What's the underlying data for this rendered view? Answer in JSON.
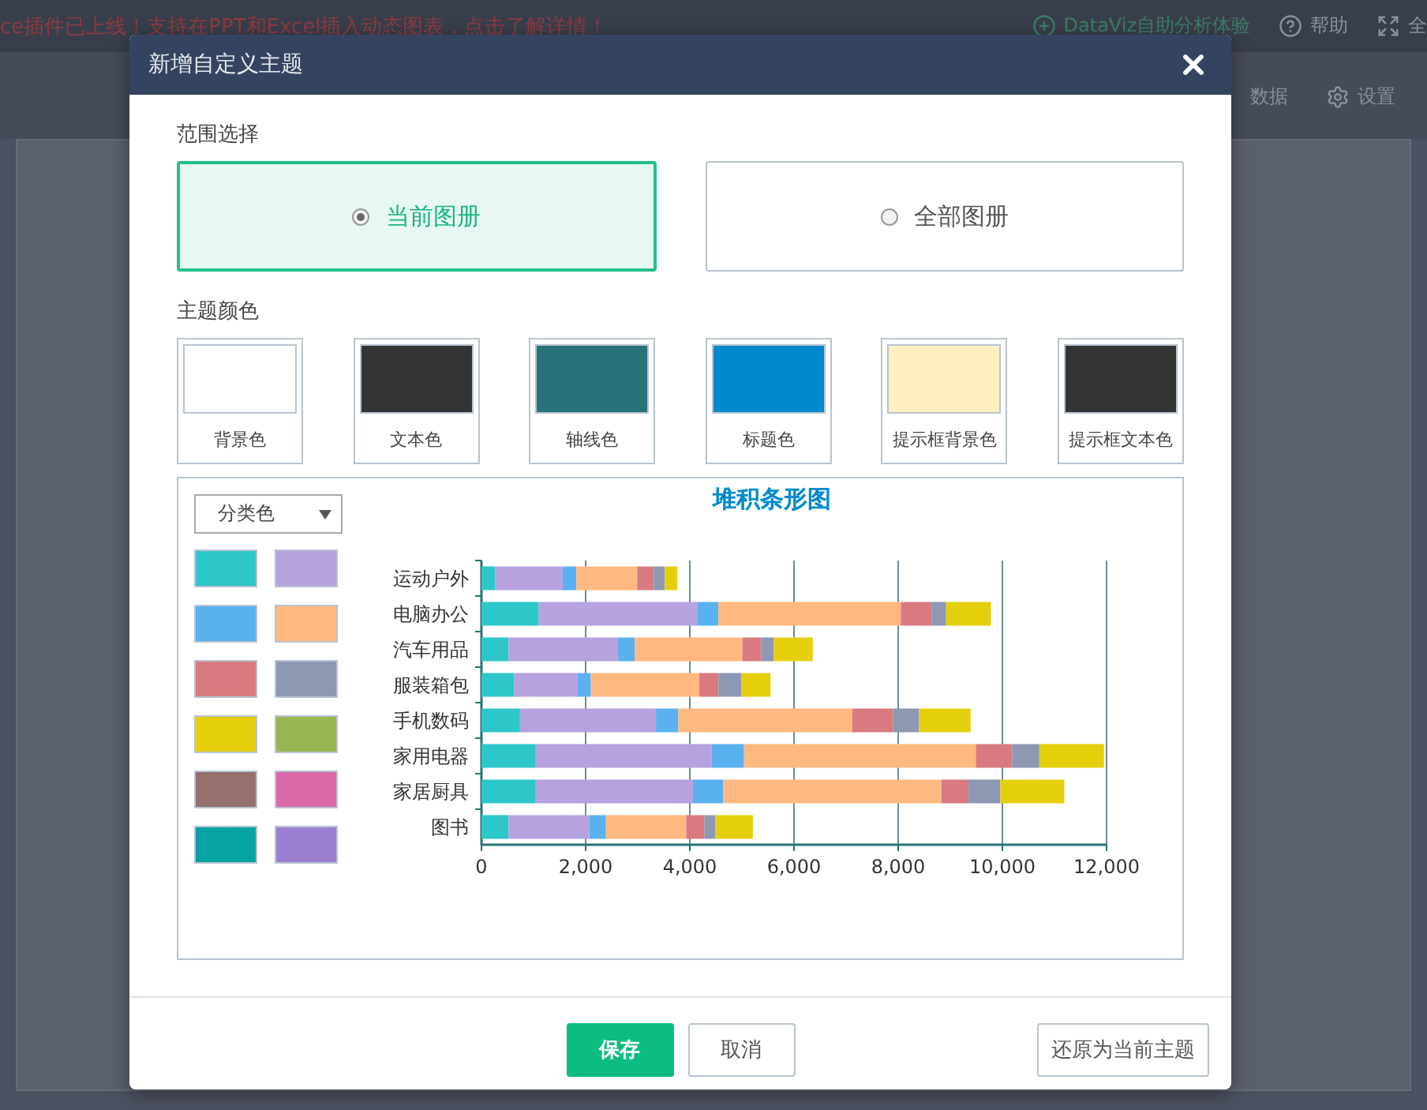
{
  "background": {
    "banner": "ce插件已上线！支持在PPT和Excel插入动态图表，点击了解详情！",
    "header_links": [
      {
        "label": "DataViz自助分析体验",
        "kind": "plus"
      },
      {
        "label": "帮助",
        "kind": "help"
      },
      {
        "label": "全",
        "kind": "expand"
      }
    ],
    "toolbar": [
      "数据",
      "设置"
    ]
  },
  "dialog": {
    "title": "新增自定义主题",
    "scope": {
      "label": "范围选择",
      "options": [
        {
          "label": "当前图册",
          "selected": true
        },
        {
          "label": "全部图册",
          "selected": false
        }
      ]
    },
    "theme_colors": {
      "label": "主题颜色",
      "items": [
        {
          "label": "背景色",
          "color": "#ffffff"
        },
        {
          "label": "文本色",
          "color": "#333333"
        },
        {
          "label": "轴线色",
          "color": "#27727b"
        },
        {
          "label": "标题色",
          "color": "#008acd"
        },
        {
          "label": "提示框背景色",
          "color": "#fff0c1"
        },
        {
          "label": "提示框文本色",
          "color": "#333333"
        }
      ]
    },
    "preview": {
      "dropdown": "分类色",
      "palette": [
        {
          "color": "#2ec7c9"
        },
        {
          "color": "#b6a2de"
        },
        {
          "color": "#5ab1ef"
        },
        {
          "color": "#ffb980"
        },
        {
          "color": "#d87a80"
        },
        {
          "color": "#8d98b3"
        },
        {
          "color": "#e5cf0d"
        },
        {
          "color": "#97b552"
        },
        {
          "color": "#95706d"
        },
        {
          "color": "#dc69aa"
        },
        {
          "color": "#07a2a4"
        },
        {
          "color": "#9a7fd1"
        }
      ],
      "chart_data": {
        "type": "bar",
        "orientation": "horizontal",
        "stacked": true,
        "title": "堆积条形图",
        "categories": [
          "运动户外",
          "电脑办公",
          "汽车用品",
          "服装箱包",
          "手机数码",
          "家用电器",
          "家居厨具",
          "图书"
        ],
        "series": [
          {
            "color": "#2ec7c9",
            "values": [
              260,
              1100,
              520,
              630,
              740,
              1030,
              1030,
              520
            ]
          },
          {
            "color": "#b6a2de",
            "values": [
              1300,
              3040,
              2100,
              1210,
              2610,
              3390,
              3030,
              1550
            ]
          },
          {
            "color": "#5ab1ef",
            "values": [
              260,
              410,
              320,
              260,
              430,
              620,
              580,
              320
            ]
          },
          {
            "color": "#ffb980",
            "values": [
              1170,
              3500,
              2070,
              2080,
              3340,
              4450,
              4190,
              1540
            ]
          },
          {
            "color": "#d87a80",
            "values": [
              320,
              590,
              360,
              370,
              780,
              700,
              520,
              350
            ]
          },
          {
            "color": "#8d98b3",
            "values": [
              210,
              280,
              240,
              440,
              500,
              520,
              610,
              210
            ]
          },
          {
            "color": "#e5cf0d",
            "values": [
              240,
              860,
              750,
              560,
              990,
              1240,
              1230,
              720
            ]
          }
        ],
        "xlim": [
          0,
          12000
        ],
        "grid": true,
        "xticks": [
          {
            "value": 0,
            "label": "0"
          },
          {
            "value": 2000,
            "label": "2,000"
          },
          {
            "value": 4000,
            "label": "4,000"
          },
          {
            "value": 6000,
            "label": "6,000"
          },
          {
            "value": 8000,
            "label": "8,000"
          },
          {
            "value": 10000,
            "label": "10,000"
          },
          {
            "value": 12000,
            "label": "12,000"
          }
        ]
      }
    },
    "buttons": [
      {
        "label": "保存",
        "kind": "primary"
      },
      {
        "label": "取消",
        "kind": "secondary"
      }
    ],
    "reset_button": "还原为当前主题"
  }
}
